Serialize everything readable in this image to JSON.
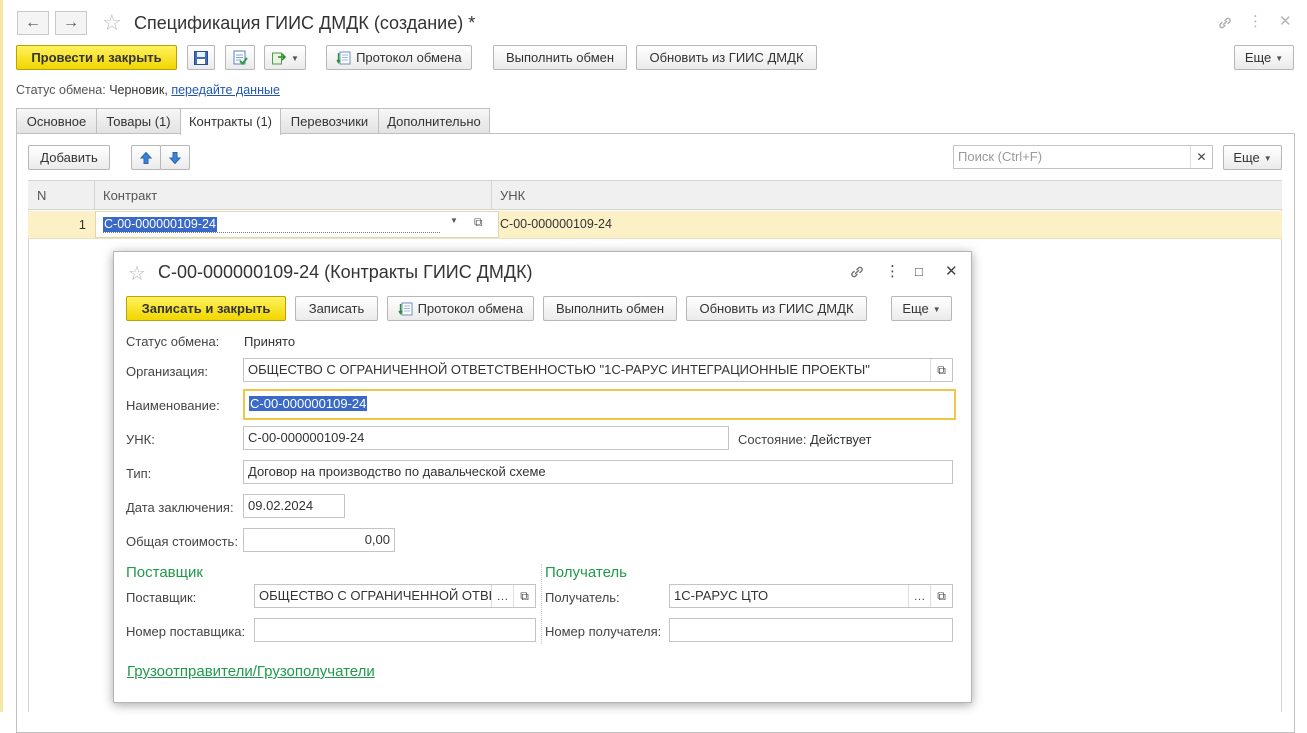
{
  "window": {
    "title": "Спецификация ГИИС ДМДК (создание) *",
    "more_label": "Еще"
  },
  "toolbar": {
    "post_close": "Провести и закрыть",
    "protocol": "Протокол обмена",
    "execute": "Выполнить обмен",
    "update": "Обновить из ГИИС ДМДК"
  },
  "status": {
    "label": "Статус обмена:",
    "value": "Черновик,",
    "link": "передайте данные"
  },
  "tabs": [
    {
      "label": "Основное"
    },
    {
      "label": "Товары (1)"
    },
    {
      "label": "Контракты (1)"
    },
    {
      "label": "Перевозчики"
    },
    {
      "label": "Дополнительно"
    }
  ],
  "table_toolbar": {
    "add": "Добавить",
    "search_placeholder": "Поиск (Ctrl+F)",
    "more": "Еще"
  },
  "table": {
    "columns": [
      "N",
      "Контракт",
      "УНК"
    ],
    "rows": [
      {
        "n": "1",
        "contract": "С-00-000000109-24",
        "unk": "С-00-000000109-24"
      }
    ]
  },
  "dialog": {
    "title": "С-00-000000109-24 (Контракты ГИИС ДМДК)",
    "buttons": {
      "save_close": "Записать и закрыть",
      "save": "Записать",
      "protocol": "Протокол обмена",
      "execute": "Выполнить обмен",
      "update": "Обновить из ГИИС ДМДК",
      "more": "Еще"
    },
    "fields": {
      "status_label": "Статус обмена:",
      "status_value": "Принято",
      "org_label": "Организация:",
      "org_value": "ОБЩЕСТВО С ОГРАНИЧЕННОЙ ОТВЕТСТВЕННОСТЬЮ \"1С-РАРУС ИНТЕГРАЦИОННЫЕ ПРОЕКТЫ\"",
      "name_label": "Наименование:",
      "name_value": "С-00-000000109-24",
      "unk_label": "УНК:",
      "unk_value": "С-00-000000109-24",
      "state_label": "Состояние:",
      "state_value": "Действует",
      "type_label": "Тип:",
      "type_value": "Договор на производство по давальческой схеме",
      "date_label": "Дата заключения:",
      "date_value": "09.02.2024",
      "cost_label": "Общая стоимость:",
      "cost_value": "0,00"
    },
    "supplier": {
      "section": "Поставщик",
      "label": "Поставщик:",
      "value": "ОБЩЕСТВО С ОГРАНИЧЕННОЙ ОТВЕТСТВЕННОСТЬЮ",
      "number_label": "Номер  поставщика:",
      "number_value": ""
    },
    "recipient": {
      "section": "Получатель",
      "label": "Получатель:",
      "value": "1С-РАРУС ЦТО",
      "number_label": "Номер  получателя:",
      "number_value": ""
    },
    "shippers_link": "Грузоотправители/Грузополучатели"
  }
}
